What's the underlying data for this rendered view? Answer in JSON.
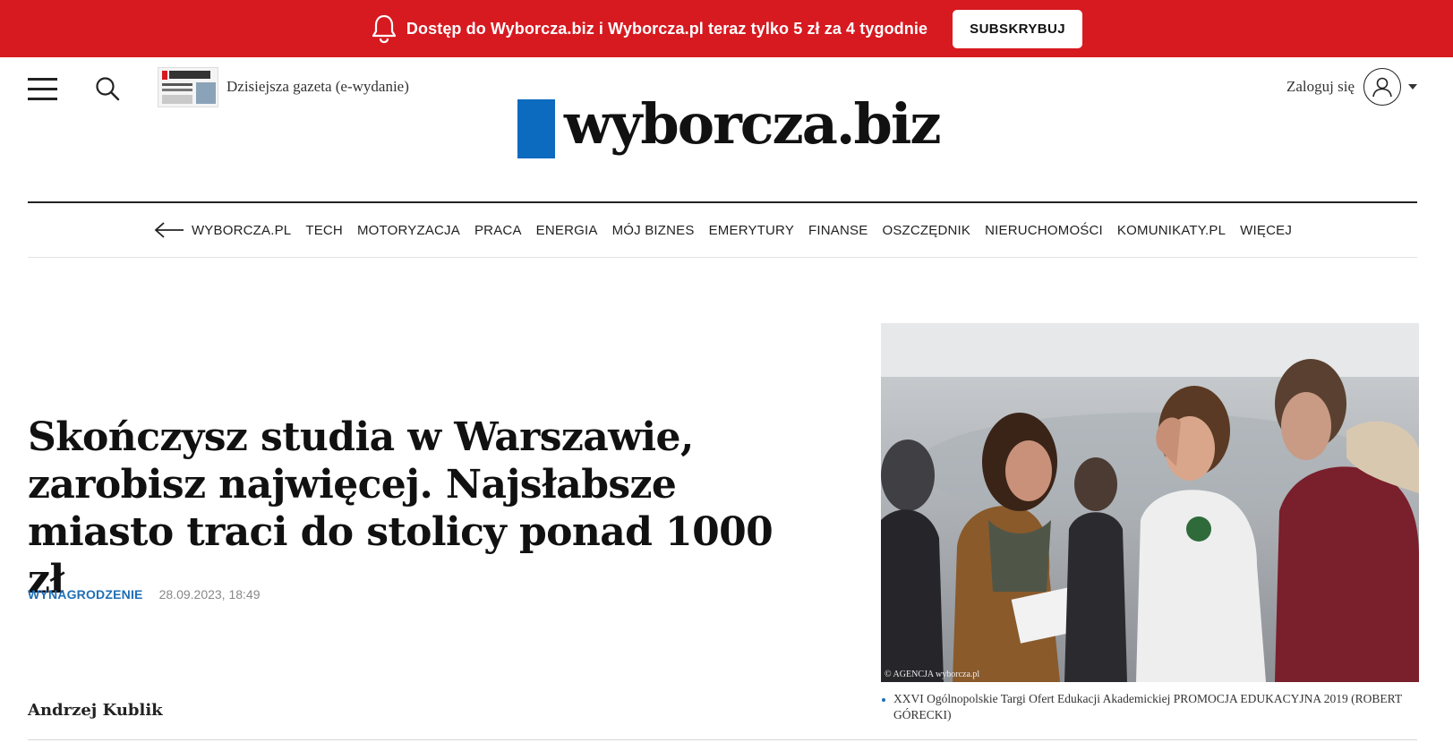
{
  "promo": {
    "text": "Dostęp do Wyborcza.biz i Wyborcza.pl teraz tylko 5 zł za 4 tygodnie",
    "button_label": "SUBSKRYBUJ",
    "background_color": "#d71920"
  },
  "header": {
    "edition_link": "Dzisiejsza gazeta (e-wydanie)",
    "logo_text": "wyborcza.biz",
    "logo_bar_color": "#0d6bbf",
    "login_label": "Zaloguj się"
  },
  "nav": {
    "items": [
      "WYBORCZA.PL",
      "TECH",
      "MOTORYZACJA",
      "PRACA",
      "ENERGIA",
      "MÓJ BIZNES",
      "EMERYTURY",
      "FINANSE",
      "OSZCZĘDNIK",
      "NIERUCHOMOŚCI",
      "KOMUNIKATY.PL",
      "WIĘCEJ"
    ]
  },
  "article": {
    "headline": "Skończysz studia w Warszawie, zarobisz najwięcej. Najsłabsze miasto traci do stolicy ponad 1000 zł",
    "category": "WYNAGRODZENIE",
    "date": "28.09.2023, 18:49",
    "author": "Andrzej Kublik",
    "photo_credit": "© AGENCJA wyborcza.pl",
    "photo_caption": "XXVI Ogólnopolskie Targi Ofert Edukacji Akademickiej PROMOCJA EDUKACYJNA 2019 (ROBERT GÓRECKI)",
    "category_color": "#1f6fb5"
  }
}
